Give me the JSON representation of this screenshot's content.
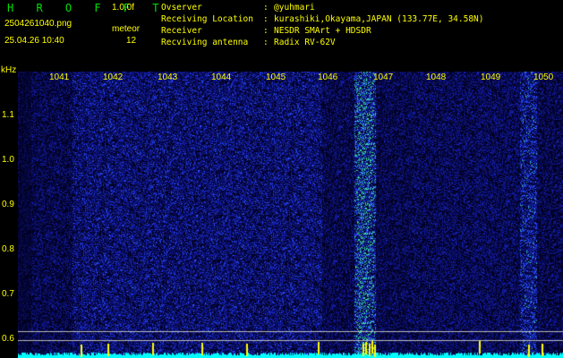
{
  "header": {
    "logo": "H R O F F T",
    "version": "1.0.0f",
    "filename": "2504261040.png",
    "timestamp": "25.04.26 10:40",
    "meteor_label": "meteor",
    "meteor_count": "12"
  },
  "info": [
    {
      "key": "Ovserver",
      "value": "@yuhmari"
    },
    {
      "key": "Receiving Location",
      "value": "kurashiki,Okayama,JAPAN (133.77E, 34.58N)"
    },
    {
      "key": "Receiver",
      "value": "NESDR SMArt + HDSDR"
    },
    {
      "key": "Recviving antenna",
      "value": "Radix RV-62V"
    }
  ],
  "axis": {
    "y_unit": "kHz",
    "y_ticks": [
      "1.1",
      "1.0",
      "0.9",
      "0.8",
      "0.7",
      "0.6"
    ],
    "x_ticks": [
      "1041",
      "1042",
      "1043",
      "1044",
      "1045",
      "1046",
      "1047",
      "1048",
      "1049",
      "1050"
    ]
  },
  "colors": {
    "text": "#ffff00",
    "logo": "#00e000",
    "background": "#000000",
    "signal": "#00ffff"
  }
}
